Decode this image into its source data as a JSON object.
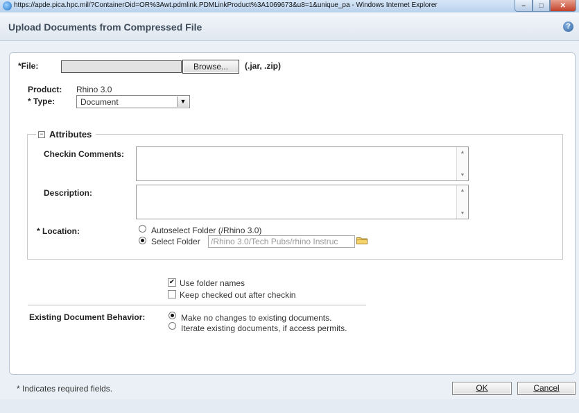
{
  "window": {
    "title_bar": "https://apde.pica.hpc.mil/?ContainerOid=OR%3Awt.pdmlink.PDMLinkProduct%3A1069673&u8=1&unique_pa - Windows Internet Explorer"
  },
  "header": {
    "page_title": "Upload Documents from Compressed File",
    "help_glyph": "?"
  },
  "file": {
    "label": "*File:",
    "value": "",
    "browse_label": "Browse...",
    "extensions_hint": "(.jar, .zip)"
  },
  "product": {
    "label": "Product:",
    "value": "Rhino 3.0"
  },
  "type": {
    "label": "* Type:",
    "selected": "Document"
  },
  "attributes": {
    "heading": "Attributes",
    "checkin_comments_label": "Checkin Comments:",
    "checkin_comments_value": "",
    "description_label": "Description:",
    "description_value": "",
    "location_label": "* Location:",
    "autoselect_label": "Autoselect Folder (/Rhino 3.0)",
    "select_folder_label": "Select Folder",
    "select_folder_value": "/Rhino 3.0/Tech Pubs/rhino Instruc",
    "location_selected": "select_folder"
  },
  "options": {
    "use_folder_names_label": "Use folder names",
    "use_folder_names_checked": true,
    "keep_checked_out_label": "Keep checked out after checkin",
    "keep_checked_out_checked": false
  },
  "existing_behavior": {
    "label": "Existing Document Behavior:",
    "option_no_changes": "Make no changes to existing documents.",
    "option_iterate": "Iterate existing documents, if access permits.",
    "selected": "no_changes"
  },
  "footer": {
    "required_note": "* Indicates required fields.",
    "ok_label": "OK",
    "cancel_label": "Cancel"
  },
  "icons": {
    "browser": "ie-icon",
    "help": "help-icon",
    "collapse": "collapse-icon",
    "folder": "folder-icon",
    "dropdown": "chevron-down-icon"
  },
  "colors": {
    "title_bar": "#b9d1ec",
    "background": "#eaf0f6",
    "panel": "#ffffff",
    "close_button": "#c2412a"
  }
}
